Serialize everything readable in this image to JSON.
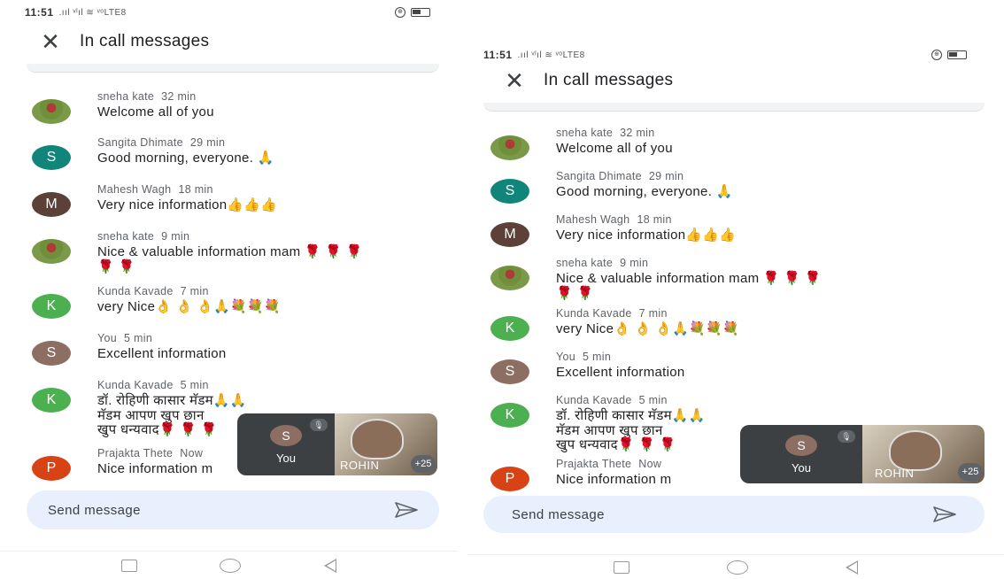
{
  "status": {
    "time": "11:51",
    "signal": ".ııl ᵛˡıl ≋ ᵛᵒLTE8"
  },
  "header": {
    "title": "In call messages",
    "close_icon": "close-icon"
  },
  "messages": [
    {
      "name": "sneha kate",
      "time": "32 min",
      "text": "Welcome all of you",
      "avatar": "photo",
      "initial": "",
      "color": ""
    },
    {
      "name": "Sangita Dhimate",
      "time": "29 min",
      "text": "Good morning, everyone. 🙏",
      "avatar": "letter",
      "initial": "S",
      "color": "#12857a"
    },
    {
      "name": "Mahesh Wagh",
      "time": "18 min",
      "text": "Very nice information👍👍👍",
      "avatar": "letter",
      "initial": "M",
      "color": "#5d4037"
    },
    {
      "name": "sneha kate",
      "time": "9 min",
      "text": "Nice & valuable information mam 🌹 🌹 🌹\n🌹 🌹",
      "avatar": "photo",
      "initial": "",
      "color": ""
    },
    {
      "name": "Kunda Kavade",
      "time": "7 min",
      "text": "very Nice👌 👌 👌🙏💐💐💐",
      "avatar": "letter",
      "initial": "K",
      "color": "#4caf50"
    },
    {
      "name": "You",
      "time": "5 min",
      "text": "Excellent information",
      "avatar": "letter",
      "initial": "S",
      "color": "#8d6e63"
    },
    {
      "name": "Kunda Kavade",
      "time": "5 min",
      "text": "डॉ. रोहिणी कासार मॅडम🙏🙏\nमॅडम आपण खुप छान\nखुप धन्यवाद🌹 🌹 🌹",
      "avatar": "letter",
      "initial": "K",
      "color": "#4caf50"
    },
    {
      "name": "Prajakta Thete",
      "time": "Now",
      "text": "Nice information m",
      "avatar": "letter",
      "initial": "P",
      "color": "#d84315"
    }
  ],
  "pip": {
    "you_initial": "S",
    "you_label": "You",
    "cam_name": "ROHIN",
    "participant_count": "+25"
  },
  "compose": {
    "placeholder": "Send message"
  },
  "colors": {
    "accent": "#1a73e8",
    "compose_bg": "#e8f0fe"
  }
}
